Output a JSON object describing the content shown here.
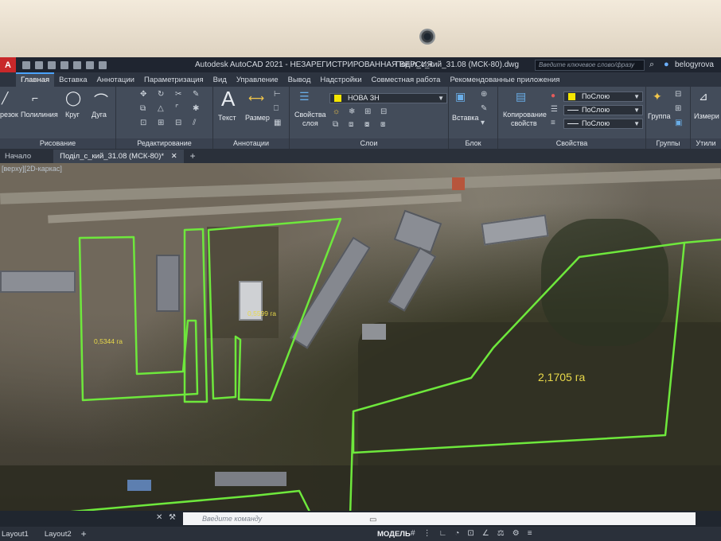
{
  "window": {
    "app_logo": "A",
    "title": "Autodesk AutoCAD 2021 - НЕЗАРЕГИСТРИРОВАННАЯ ВЕРСИЯ",
    "file": "Поділ_с_кий_31.08 (МСК-80).dwg",
    "search_placeholder": "Введите ключевое слово/фразу",
    "user": "belogyrova"
  },
  "ribbon_tabs": [
    {
      "label": "Главная",
      "active": true
    },
    {
      "label": "Вставка"
    },
    {
      "label": "Аннотации"
    },
    {
      "label": "Параметризация"
    },
    {
      "label": "Вид"
    },
    {
      "label": "Управление"
    },
    {
      "label": "Вывод"
    },
    {
      "label": "Надстройки"
    },
    {
      "label": "Совместная работа"
    },
    {
      "label": "Рекомендованные приложения"
    }
  ],
  "ribbon": {
    "draw": {
      "cut": "резок",
      "polyline": "Полилиния",
      "circle": "Круг",
      "arc": "Дуга",
      "title": "Рисование"
    },
    "modify": {
      "title": "Редактирование"
    },
    "annotation": {
      "text": "Текст",
      "dimension": "Размер",
      "title": "Аннотации"
    },
    "layers": {
      "properties_line1": "Свойства",
      "properties_line2": "слоя",
      "current_layer": "НОВА ЗН",
      "title": "Слои"
    },
    "block": {
      "insert": "Вставка",
      "title": "Блок"
    },
    "properties": {
      "copy_line1": "Копирование",
      "copy_line2": "свойств",
      "color": "ПоСлою",
      "linetype": "ПоСлою",
      "lineweight": "ПоСлою",
      "title": "Свойства"
    },
    "groups": {
      "group": "Группа",
      "title": "Группы"
    },
    "utilities": {
      "measure": "Измери",
      "title": "Утили"
    }
  },
  "doc_tabs": {
    "start": "Начало",
    "active": "Поділ_с_кий_31.08 (МСК-80)*",
    "close": "✕",
    "add": "+"
  },
  "viewport_label": "[верху][2D-каркас]",
  "plots": [
    {
      "area": "0,5344 га"
    },
    {
      "area": "0,5599 га"
    },
    {
      "area": "2,1705 га"
    }
  ],
  "command_line": {
    "placeholder": "Введите команду",
    "close": "✕"
  },
  "layout_tabs": [
    "Layout1",
    "Layout2"
  ],
  "layout_add": "+",
  "status": {
    "model": "МОДЕЛЬ"
  },
  "colors": {
    "plot_outline": "#6ee83c",
    "area_label": "#e9d94a",
    "ribbon_bg": "#434c5a",
    "active_tab_accent": "#4aa3ff"
  }
}
